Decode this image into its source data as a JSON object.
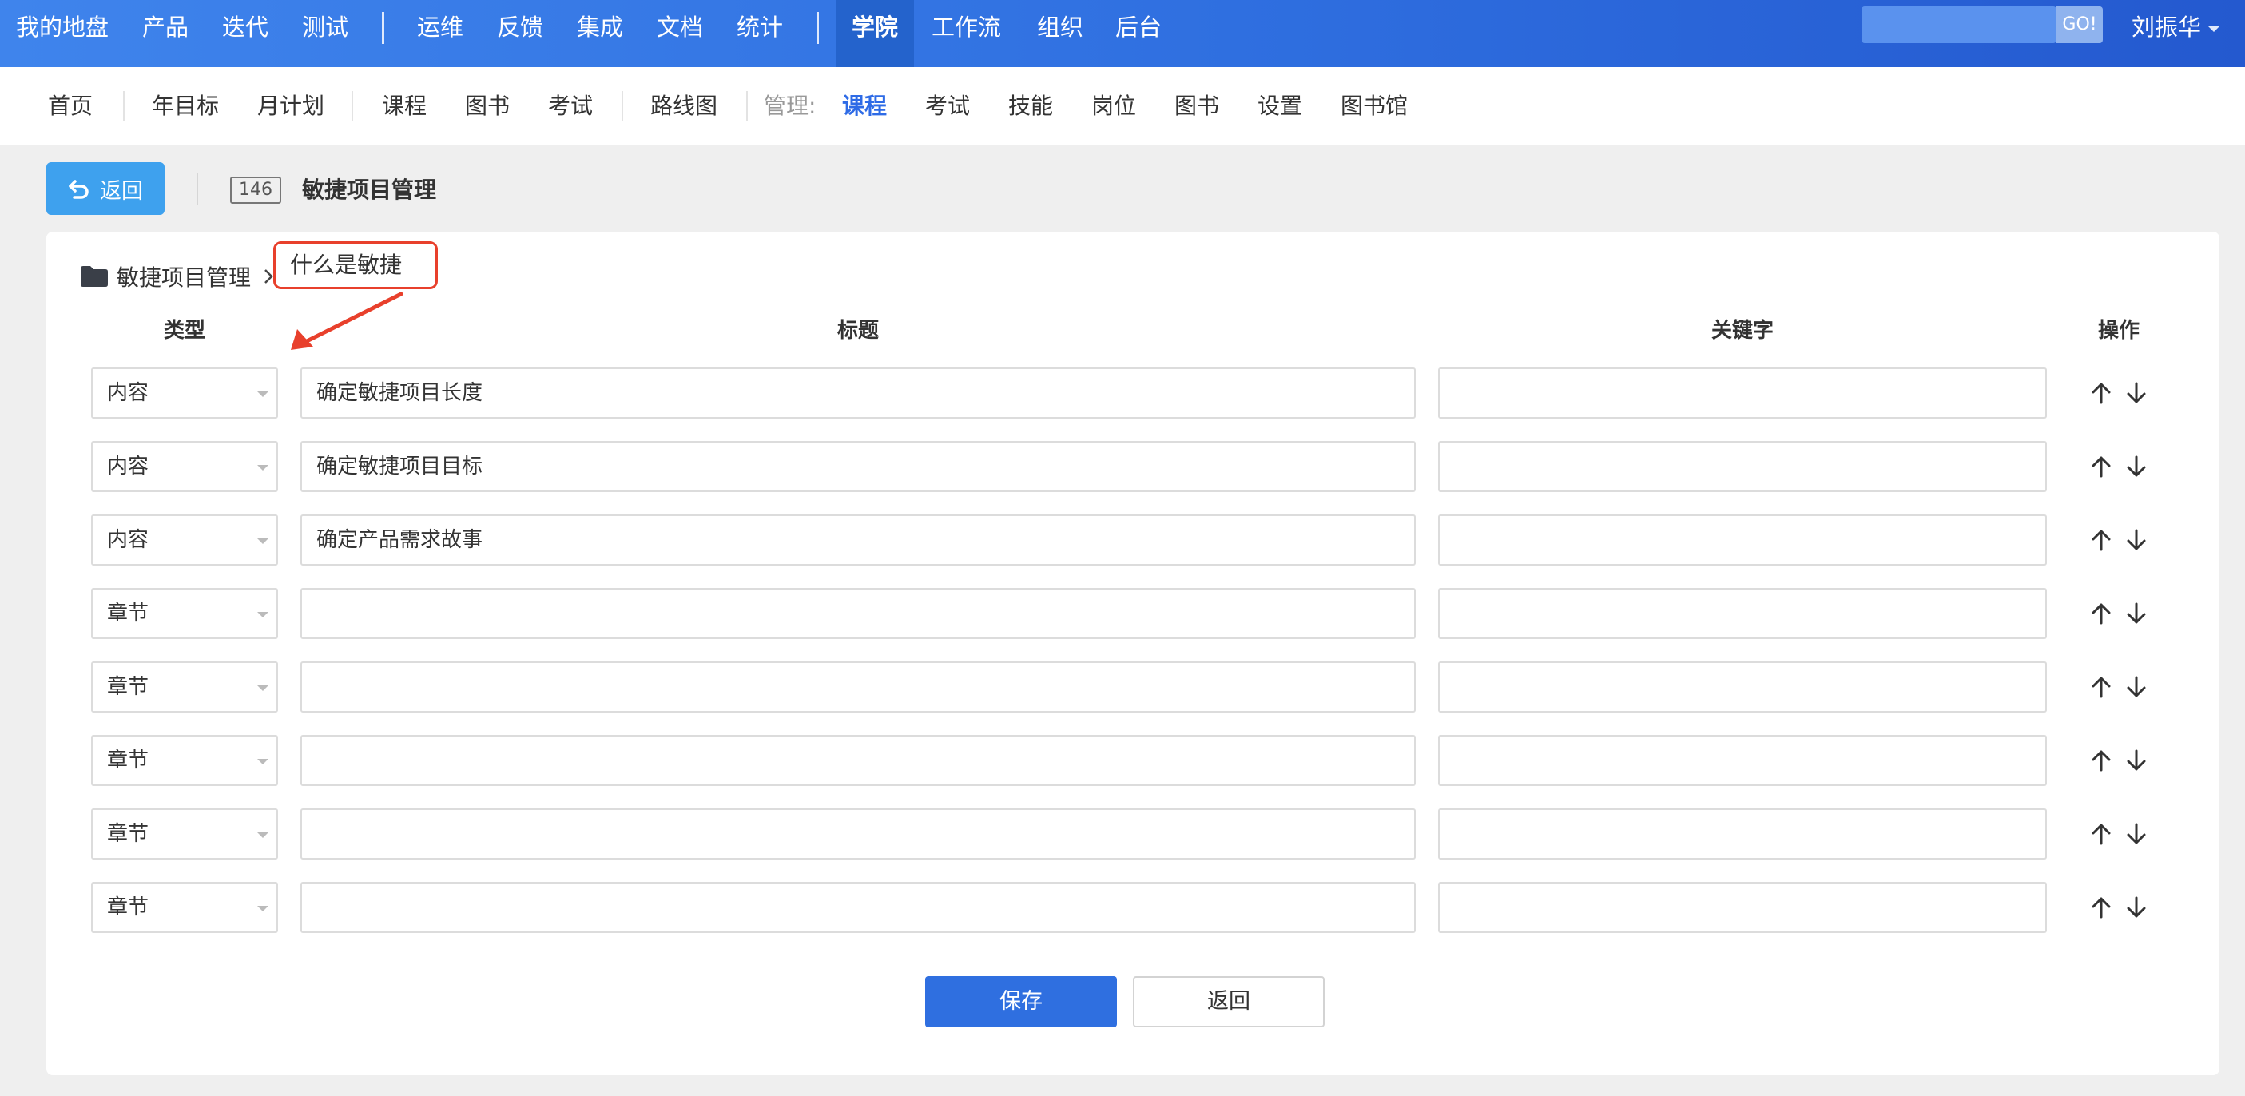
{
  "topnav": {
    "items": [
      "我的地盘",
      "产品",
      "迭代",
      "测试",
      "运维",
      "反馈",
      "集成",
      "文档",
      "统计",
      "学院",
      "工作流",
      "组织",
      "后台"
    ],
    "active": "学院",
    "search_placeholder": "",
    "go_label": "GO!",
    "user_name": "刘振华"
  },
  "subnav": {
    "items": [
      "首页",
      "年目标",
      "月计划",
      "课程",
      "图书",
      "考试",
      "路线图"
    ],
    "manage_label": "管理:",
    "manage_items": [
      "课程",
      "考试",
      "技能",
      "岗位",
      "图书",
      "设置",
      "图书馆"
    ],
    "active": "课程"
  },
  "header": {
    "back_label": "返回",
    "id": "146",
    "title": "敏捷项目管理"
  },
  "breadcrumb": {
    "root": "敏捷项目管理",
    "current": "什么是敏捷"
  },
  "table": {
    "columns": [
      "类型",
      "标题",
      "关键字",
      "操作"
    ],
    "rows": [
      {
        "type": "内容",
        "title": "确定敏捷项目长度",
        "keyword": ""
      },
      {
        "type": "内容",
        "title": "确定敏捷项目目标",
        "keyword": ""
      },
      {
        "type": "内容",
        "title": "确定产品需求故事",
        "keyword": ""
      },
      {
        "type": "章节",
        "title": "",
        "keyword": ""
      },
      {
        "type": "章节",
        "title": "",
        "keyword": ""
      },
      {
        "type": "章节",
        "title": "",
        "keyword": ""
      },
      {
        "type": "章节",
        "title": "",
        "keyword": ""
      },
      {
        "type": "章节",
        "title": "",
        "keyword": ""
      }
    ],
    "move_up_icon": "arrow-up-icon",
    "move_down_icon": "arrow-down-icon"
  },
  "actions": {
    "save_label": "保存",
    "cancel_label": "返回"
  },
  "colors": {
    "nav_blue": "#2f6fe0",
    "back_button": "#3ea1ee",
    "annotation_red": "#e8402c"
  }
}
